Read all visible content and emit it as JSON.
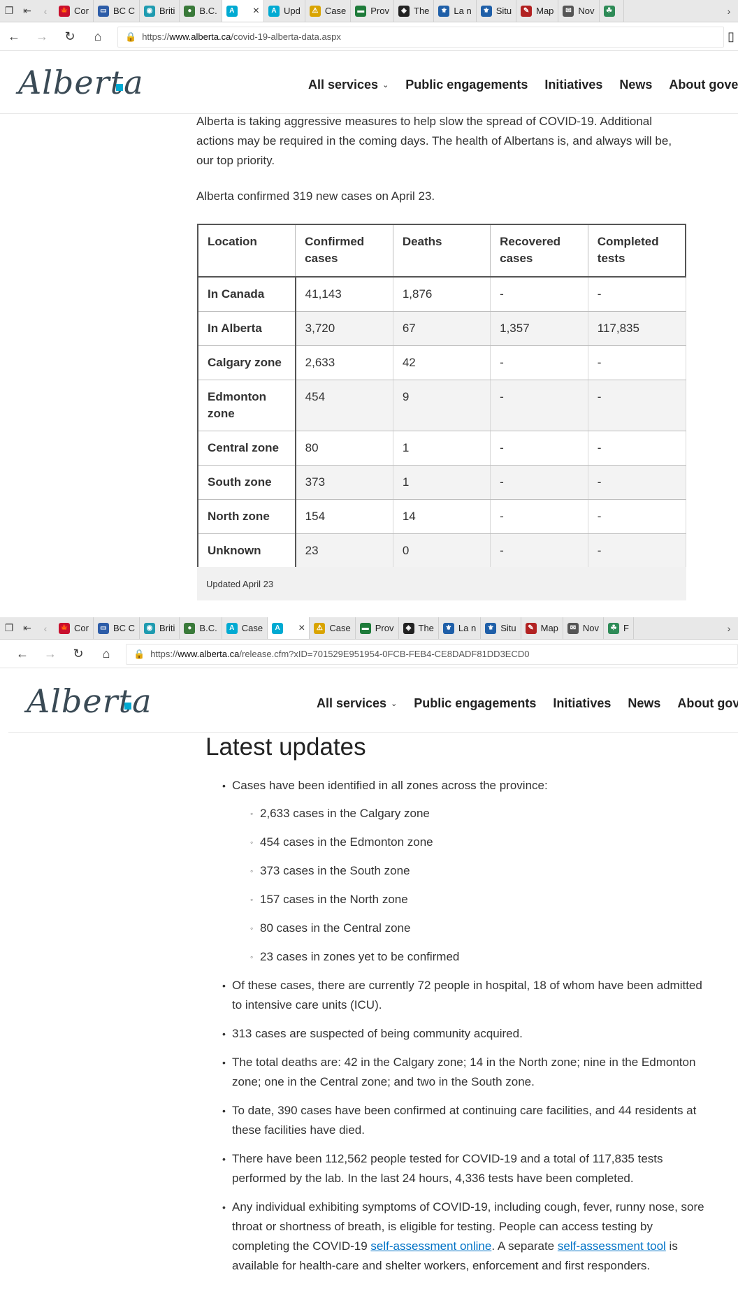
{
  "window1": {
    "tabs": [
      {
        "label": "Cor",
        "color": "#c8102e",
        "glyph": "🍁"
      },
      {
        "label": "BC C",
        "color": "#2d5da8",
        "glyph": "▭"
      },
      {
        "label": "Briti",
        "color": "#1f9bb0",
        "glyph": "◉"
      },
      {
        "label": "B.C.",
        "color": "#3a7a3a",
        "glyph": "●"
      },
      {
        "label": "",
        "color": "#00aad2",
        "glyph": "A",
        "active": true
      },
      {
        "label": "Upd",
        "color": "#00aad2",
        "glyph": "A"
      },
      {
        "label": "Case",
        "color": "#d9a400",
        "glyph": "⚠"
      },
      {
        "label": "Prov",
        "color": "#1e7b3a",
        "glyph": "▬"
      },
      {
        "label": "The",
        "color": "#222222",
        "glyph": "◈"
      },
      {
        "label": "La n",
        "color": "#1f5fa8",
        "glyph": "⚜"
      },
      {
        "label": "Situ",
        "color": "#1f5fa8",
        "glyph": "⚜"
      },
      {
        "label": "Map",
        "color": "#b22222",
        "glyph": "✎"
      },
      {
        "label": "Nov",
        "color": "#555555",
        "glyph": "✉"
      },
      {
        "label": "",
        "color": "#2e8b57",
        "glyph": "☘"
      }
    ],
    "url_prefix": "https://",
    "url_domain": "www.alberta.ca",
    "url_path": "/covid-19-alberta-data.aspx"
  },
  "window2": {
    "tabs": [
      {
        "label": "Cor",
        "color": "#c8102e",
        "glyph": "🍁"
      },
      {
        "label": "BC C",
        "color": "#2d5da8",
        "glyph": "▭"
      },
      {
        "label": "Briti",
        "color": "#1f9bb0",
        "glyph": "◉"
      },
      {
        "label": "B.C.",
        "color": "#3a7a3a",
        "glyph": "●"
      },
      {
        "label": "Case",
        "color": "#00aad2",
        "glyph": "A"
      },
      {
        "label": "",
        "color": "#00aad2",
        "glyph": "A",
        "active": true
      },
      {
        "label": "Case",
        "color": "#d9a400",
        "glyph": "⚠"
      },
      {
        "label": "Prov",
        "color": "#1e7b3a",
        "glyph": "▬"
      },
      {
        "label": "The",
        "color": "#222222",
        "glyph": "◈"
      },
      {
        "label": "La n",
        "color": "#1f5fa8",
        "glyph": "⚜"
      },
      {
        "label": "Situ",
        "color": "#1f5fa8",
        "glyph": "⚜"
      },
      {
        "label": "Map",
        "color": "#b22222",
        "glyph": "✎"
      },
      {
        "label": "Nov",
        "color": "#555555",
        "glyph": "✉"
      },
      {
        "label": "F",
        "color": "#2e8b57",
        "glyph": "☘"
      }
    ],
    "url_prefix": "https://",
    "url_domain": "www.alberta.ca",
    "url_path": "/release.cfm?xID=701529E951954-0FCB-FEB4-CE8DADF81DD3ECD0"
  },
  "site": {
    "logo": "Alberta",
    "nav": [
      "All services",
      "Public engagements",
      "Initiatives",
      "News",
      "About governm"
    ]
  },
  "page1": {
    "intro": "Alberta is taking aggressive measures to help slow the spread of COVID-19. Additional actions may be required in the coming days. The health of Albertans is, and always will be, our top priority.",
    "confirmed_line": "Alberta confirmed 319 new cases on April 23.",
    "table": {
      "headers": [
        "Location",
        "Confirmed cases",
        "Deaths",
        "Recovered cases",
        "Completed tests"
      ],
      "rows": [
        [
          "In Canada",
          "41,143",
          "1,876",
          "-",
          "-"
        ],
        [
          "In Alberta",
          "3,720",
          "67",
          "1,357",
          "117,835"
        ],
        [
          "Calgary zone",
          "2,633",
          "42",
          "-",
          "-"
        ],
        [
          "Edmonton zone",
          "454",
          "9",
          "-",
          "-"
        ],
        [
          "Central zone",
          "80",
          "1",
          "-",
          "-"
        ],
        [
          "South zone",
          "373",
          "1",
          "-",
          "-"
        ],
        [
          "North zone",
          "154",
          "14",
          "-",
          "-"
        ],
        [
          "Unknown",
          "23",
          "0",
          "-",
          "-"
        ]
      ],
      "caption": "Updated April 23"
    }
  },
  "page2": {
    "heading": "Latest updates",
    "zones_intro": "Cases have been identified in all zones across the province:",
    "zones": [
      "2,633 cases in the Calgary zone",
      "454 cases in the Edmonton zone",
      "373 cases in the South zone",
      "157 cases in the North zone",
      "80 cases in the Central zone",
      "23 cases in zones yet to be confirmed"
    ],
    "bullets": [
      "Of these cases, there are currently 72 people in hospital, 18 of whom have been admitted to intensive care units (ICU).",
      "313 cases are suspected of being community acquired.",
      "The total deaths are: 42 in the Calgary zone; 14 in the North zone; nine in the Edmonton zone; one in the Central zone; and two in the South zone.",
      "To date, 390 cases have been confirmed at continuing care facilities, and 44 residents at these facilities have died.",
      "There have been 112,562 people tested for COVID-19 and a total of 117,835 tests performed by the lab. In the last 24 hours, 4,336 tests have been completed."
    ],
    "last_bullet": {
      "part1": "Any individual exhibiting symptoms of COVID-19, including cough, fever, runny nose, sore throat or shortness of breath, is eligible for testing. People can access testing by completing the COVID-19 ",
      "link1": "self-assessment online",
      "part2": ". A separate ",
      "link2": "self-assessment tool",
      "part3": " is available for health-care and shelter workers, enforcement and first responders."
    }
  }
}
